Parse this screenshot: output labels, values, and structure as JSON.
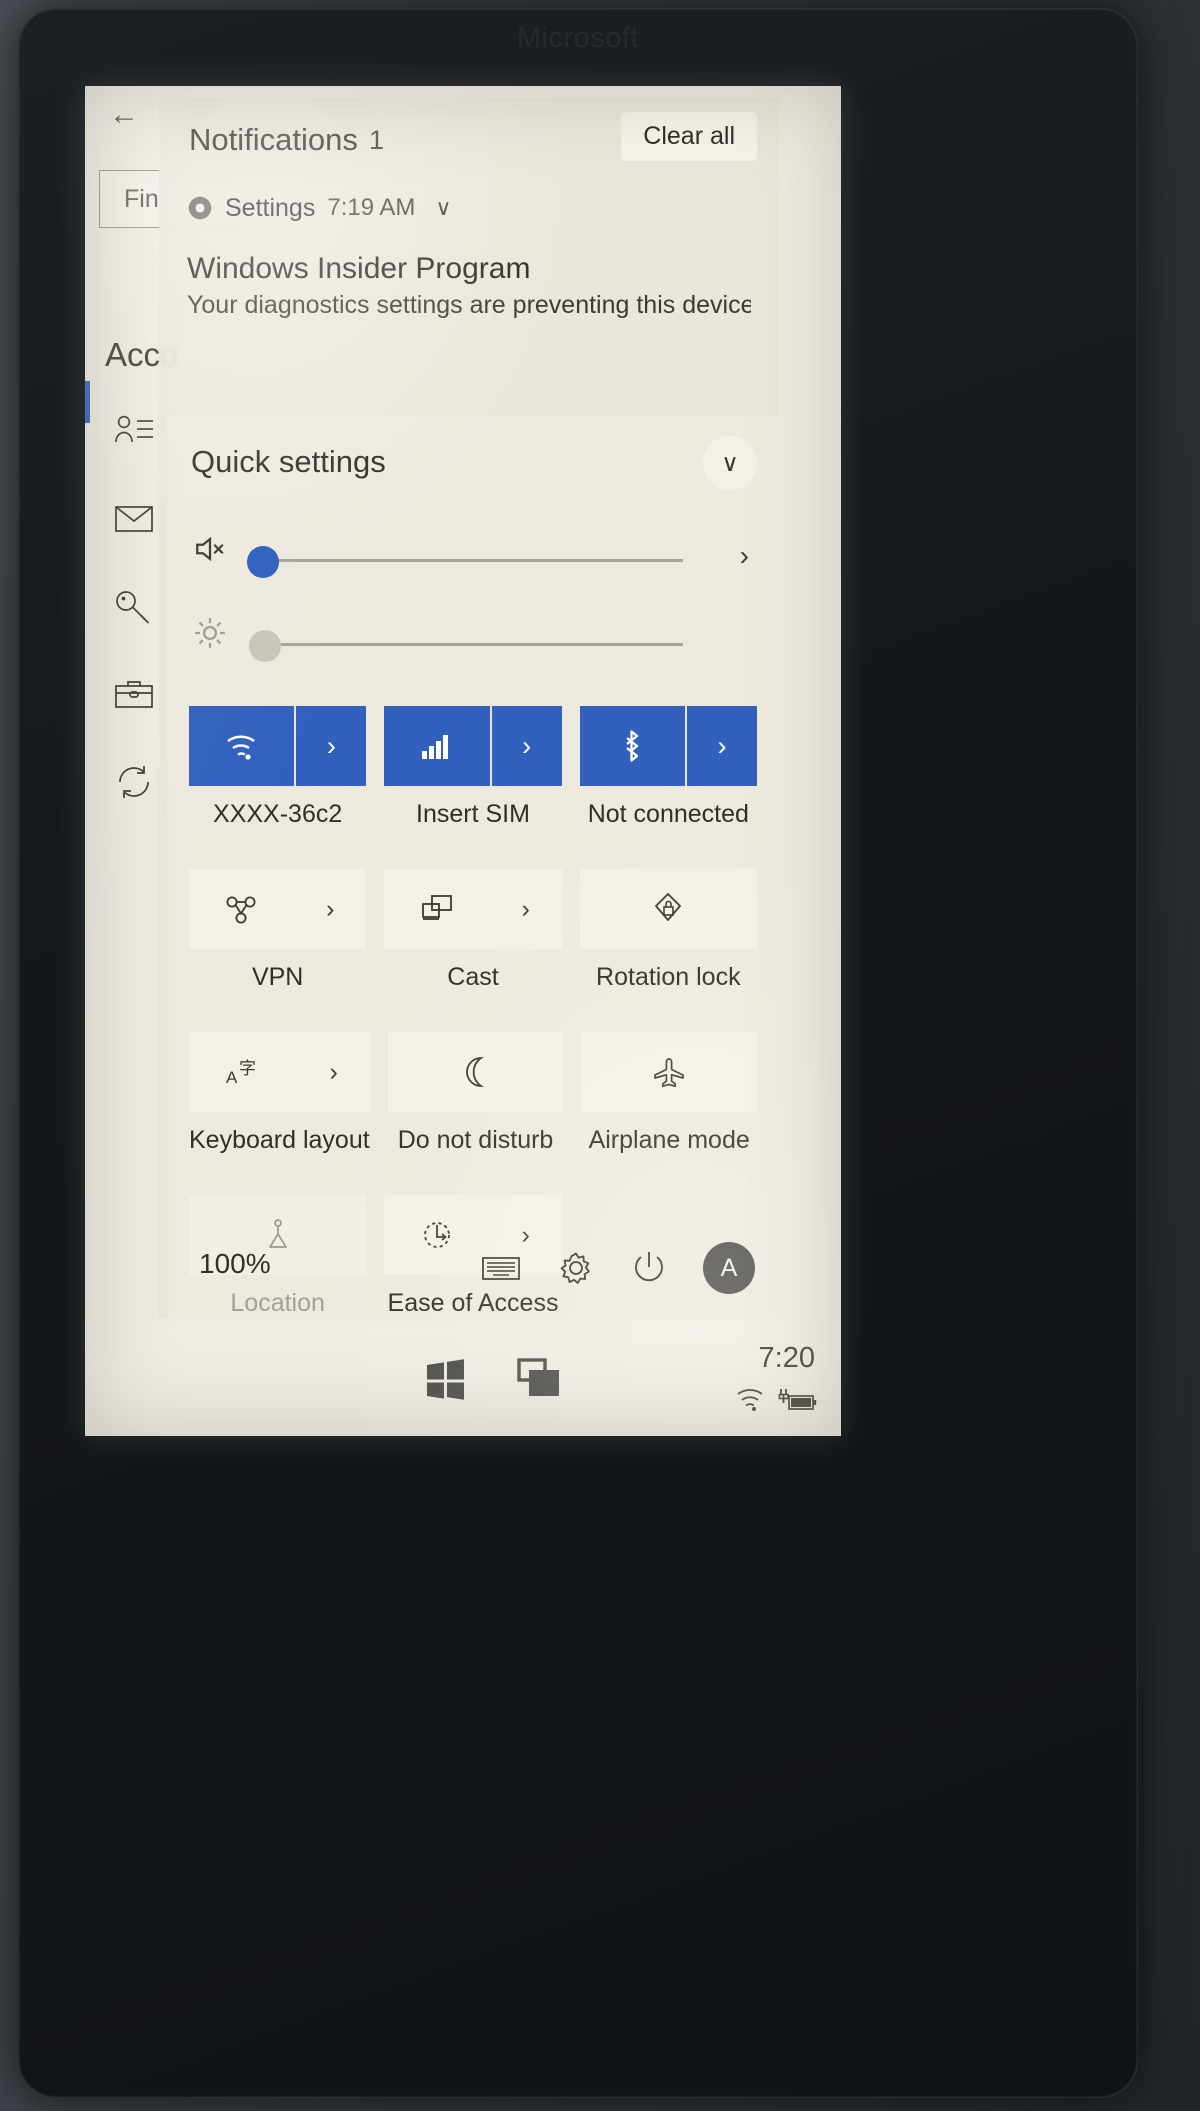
{
  "device": {
    "brand": "Microsoft"
  },
  "settings_app": {
    "back_label": "←",
    "search_value": "Fin",
    "search_placeholder": "Find a setting",
    "page_title": "Acco",
    "sidebar_items": [
      {
        "label": "Your info",
        "icon": "person-list-icon",
        "selected": true
      },
      {
        "label": "Email & accounts",
        "icon": "envelope-icon",
        "selected": false
      },
      {
        "label": "Sign-in options",
        "icon": "key-icon",
        "selected": false
      },
      {
        "label": "Access work or school",
        "icon": "briefcase-icon",
        "selected": false
      },
      {
        "label": "Sync your settings",
        "icon": "sync-icon",
        "selected": false
      }
    ]
  },
  "action_center": {
    "title": "Notifications",
    "count": "1",
    "clear_all_label": "Clear all",
    "notification": {
      "app_name": "Settings",
      "time": "7:19 AM",
      "expand_icon": "chevron-down-icon",
      "app_icon": "gear-icon",
      "heading": "Windows Insider Program",
      "body": "Your diagnostics settings are preventing this device fr"
    }
  },
  "quick_settings": {
    "title": "Quick settings",
    "collapse_icon": "chevron-down-icon",
    "sliders": [
      {
        "name": "volume",
        "icon": "speaker-mute-icon",
        "state": "on",
        "value": 0,
        "has_chevron": true
      },
      {
        "name": "brightness",
        "icon": "brightness-icon",
        "state": "off",
        "value": 0,
        "has_chevron": false
      }
    ],
    "connectivity_tiles": [
      {
        "label": "XXXX-36c2",
        "icon": "wifi-icon",
        "style": "blue",
        "arrow": true
      },
      {
        "label": "Insert SIM",
        "icon": "cellular-icon",
        "style": "blue",
        "arrow": true
      },
      {
        "label": "Not connected",
        "icon": "bluetooth-icon",
        "style": "blue",
        "arrow": true
      }
    ],
    "tiles": [
      {
        "label": "VPN",
        "icon": "vpn-icon",
        "style": "light",
        "arrow": true
      },
      {
        "label": "Cast",
        "icon": "cast-icon",
        "style": "light",
        "arrow": true
      },
      {
        "label": "Rotation lock",
        "icon": "rotation-lock-icon",
        "style": "light",
        "arrow": false
      },
      {
        "label": "Keyboard layout",
        "icon": "keyboard-layout-icon",
        "style": "light",
        "arrow": true
      },
      {
        "label": "Do not disturb",
        "icon": "moon-icon",
        "style": "light",
        "arrow": false
      },
      {
        "label": "Airplane mode",
        "icon": "airplane-icon",
        "style": "light",
        "arrow": false
      },
      {
        "label": "Location",
        "icon": "location-icon",
        "style": "dim",
        "arrow": false
      },
      {
        "label": "Ease of Access",
        "icon": "ease-of-access-icon",
        "style": "light",
        "arrow": true
      },
      {
        "label": "",
        "icon": "",
        "style": "none",
        "arrow": false
      }
    ],
    "footer": {
      "battery": "100%",
      "icons": [
        "keyboard-icon",
        "gear-icon",
        "power-icon"
      ],
      "avatar_initial": "A"
    }
  },
  "taskbar": {
    "start_icon": "windows-start-icon",
    "task_view_icon": "task-view-icon",
    "clock": "7:20",
    "tray_icons": [
      "wifi-icon",
      "battery-charging-icon"
    ]
  },
  "colors": {
    "accent_blue": "#3161bd",
    "screen_bg": "#efece3",
    "panel_bg": "#e9e5da",
    "text": "#2d2d2a",
    "dim_text": "#a3a09a"
  }
}
